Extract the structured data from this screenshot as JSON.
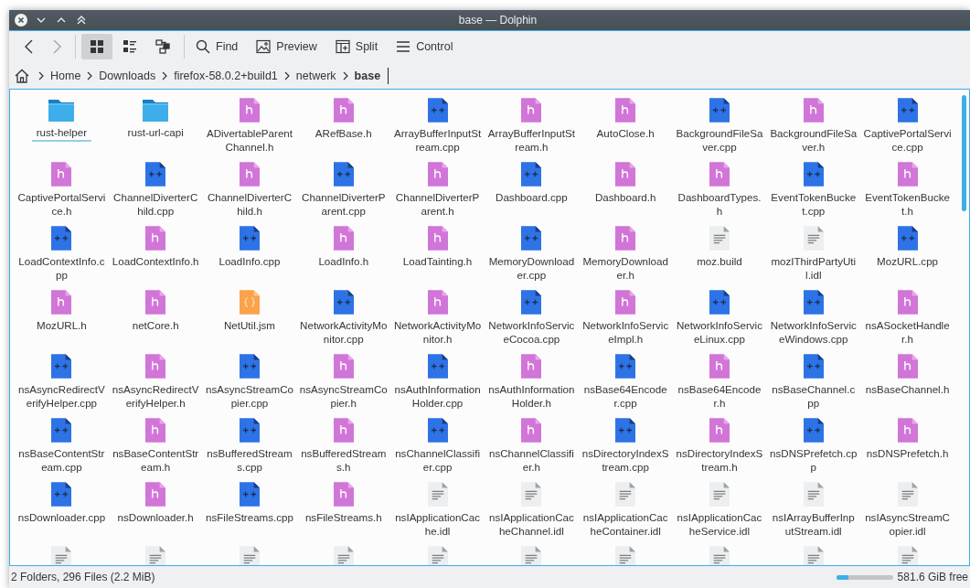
{
  "window": {
    "title": "base — Dolphin"
  },
  "toolbar": {
    "back": {
      "disabled": false
    },
    "forward": {
      "disabled": true
    },
    "view_modes": [
      {
        "kind": "icons",
        "selected": true
      },
      {
        "kind": "compact",
        "selected": false
      },
      {
        "kind": "details",
        "selected": false
      }
    ],
    "actions": [
      {
        "kind": "find",
        "label": "Find"
      },
      {
        "kind": "preview",
        "label": "Preview"
      },
      {
        "kind": "split",
        "label": "Split"
      },
      {
        "kind": "control",
        "label": "Control"
      }
    ]
  },
  "breadcrumb": [
    {
      "label": "Home",
      "current": false
    },
    {
      "label": "Downloads",
      "current": false
    },
    {
      "label": "firefox-58.0.2+build1",
      "current": false
    },
    {
      "label": "netwerk",
      "current": false
    },
    {
      "label": "base",
      "current": true
    }
  ],
  "files": [
    {
      "name": "rust-helper",
      "kind": "folder",
      "focused": true
    },
    {
      "name": "rust-url-capi",
      "kind": "folder",
      "focused": false
    },
    {
      "name": "ADivertableParentChannel.h",
      "kind": "header",
      "focused": false
    },
    {
      "name": "ARefBase.h",
      "kind": "header",
      "focused": false
    },
    {
      "name": "ArrayBufferInputStream.cpp",
      "kind": "cpp",
      "focused": false
    },
    {
      "name": "ArrayBufferInputStream.h",
      "kind": "header",
      "focused": false
    },
    {
      "name": "AutoClose.h",
      "kind": "header",
      "focused": false
    },
    {
      "name": "BackgroundFileSaver.cpp",
      "kind": "cpp",
      "focused": false
    },
    {
      "name": "BackgroundFileSaver.h",
      "kind": "header",
      "focused": false
    },
    {
      "name": "CaptivePortalService.cpp",
      "kind": "cpp",
      "focused": false
    },
    {
      "name": "CaptivePortalService.h",
      "kind": "header",
      "focused": false
    },
    {
      "name": "ChannelDiverterChild.cpp",
      "kind": "cpp",
      "focused": false
    },
    {
      "name": "ChannelDiverterChild.h",
      "kind": "header",
      "focused": false
    },
    {
      "name": "ChannelDiverterParent.cpp",
      "kind": "cpp",
      "focused": false
    },
    {
      "name": "ChannelDiverterParent.h",
      "kind": "header",
      "focused": false
    },
    {
      "name": "Dashboard.cpp",
      "kind": "cpp",
      "focused": false
    },
    {
      "name": "Dashboard.h",
      "kind": "header",
      "focused": false
    },
    {
      "name": "DashboardTypes.h",
      "kind": "header",
      "focused": false
    },
    {
      "name": "EventTokenBucket.cpp",
      "kind": "cpp",
      "focused": false
    },
    {
      "name": "EventTokenBucket.h",
      "kind": "header",
      "focused": false
    },
    {
      "name": "LoadContextInfo.cpp",
      "kind": "cpp",
      "focused": false
    },
    {
      "name": "LoadContextInfo.h",
      "kind": "header",
      "focused": false
    },
    {
      "name": "LoadInfo.cpp",
      "kind": "cpp",
      "focused": false
    },
    {
      "name": "LoadInfo.h",
      "kind": "header",
      "focused": false
    },
    {
      "name": "LoadTainting.h",
      "kind": "header",
      "focused": false
    },
    {
      "name": "MemoryDownloader.cpp",
      "kind": "cpp",
      "focused": false
    },
    {
      "name": "MemoryDownloader.h",
      "kind": "header",
      "focused": false
    },
    {
      "name": "moz.build",
      "kind": "text",
      "focused": false
    },
    {
      "name": "mozIThirdPartyUtil.idl",
      "kind": "text",
      "focused": false
    },
    {
      "name": "MozURL.cpp",
      "kind": "cpp",
      "focused": false
    },
    {
      "name": "MozURL.h",
      "kind": "header",
      "focused": false
    },
    {
      "name": "netCore.h",
      "kind": "header",
      "focused": false
    },
    {
      "name": "NetUtil.jsm",
      "kind": "script",
      "focused": false
    },
    {
      "name": "NetworkActivityMonitor.cpp",
      "kind": "cpp",
      "focused": false
    },
    {
      "name": "NetworkActivityMonitor.h",
      "kind": "header",
      "focused": false
    },
    {
      "name": "NetworkInfoServiceCocoa.cpp",
      "kind": "cpp",
      "focused": false
    },
    {
      "name": "NetworkInfoServiceImpl.h",
      "kind": "header",
      "focused": false
    },
    {
      "name": "NetworkInfoServiceLinux.cpp",
      "kind": "cpp",
      "focused": false
    },
    {
      "name": "NetworkInfoServiceWindows.cpp",
      "kind": "cpp",
      "focused": false
    },
    {
      "name": "nsASocketHandler.h",
      "kind": "header",
      "focused": false
    },
    {
      "name": "nsAsyncRedirectVerifyHelper.cpp",
      "kind": "cpp",
      "focused": false
    },
    {
      "name": "nsAsyncRedirectVerifyHelper.h",
      "kind": "header",
      "focused": false
    },
    {
      "name": "nsAsyncStreamCopier.cpp",
      "kind": "cpp",
      "focused": false
    },
    {
      "name": "nsAsyncStreamCopier.h",
      "kind": "header",
      "focused": false
    },
    {
      "name": "nsAuthInformationHolder.cpp",
      "kind": "cpp",
      "focused": false
    },
    {
      "name": "nsAuthInformationHolder.h",
      "kind": "header",
      "focused": false
    },
    {
      "name": "nsBase64Encoder.cpp",
      "kind": "cpp",
      "focused": false
    },
    {
      "name": "nsBase64Encoder.h",
      "kind": "header",
      "focused": false
    },
    {
      "name": "nsBaseChannel.cpp",
      "kind": "cpp",
      "focused": false
    },
    {
      "name": "nsBaseChannel.h",
      "kind": "header",
      "focused": false
    },
    {
      "name": "nsBaseContentStream.cpp",
      "kind": "cpp",
      "focused": false
    },
    {
      "name": "nsBaseContentStream.h",
      "kind": "header",
      "focused": false
    },
    {
      "name": "nsBufferedStreams.cpp",
      "kind": "cpp",
      "focused": false
    },
    {
      "name": "nsBufferedStreams.h",
      "kind": "header",
      "focused": false
    },
    {
      "name": "nsChannelClassifier.cpp",
      "kind": "cpp",
      "focused": false
    },
    {
      "name": "nsChannelClassifier.h",
      "kind": "header",
      "focused": false
    },
    {
      "name": "nsDirectoryIndexStream.cpp",
      "kind": "cpp",
      "focused": false
    },
    {
      "name": "nsDirectoryIndexStream.h",
      "kind": "header",
      "focused": false
    },
    {
      "name": "nsDNSPrefetch.cpp",
      "kind": "cpp",
      "focused": false
    },
    {
      "name": "nsDNSPrefetch.h",
      "kind": "header",
      "focused": false
    },
    {
      "name": "nsDownloader.cpp",
      "kind": "cpp",
      "focused": false
    },
    {
      "name": "nsDownloader.h",
      "kind": "header",
      "focused": false
    },
    {
      "name": "nsFileStreams.cpp",
      "kind": "cpp",
      "focused": false
    },
    {
      "name": "nsFileStreams.h",
      "kind": "header",
      "focused": false
    },
    {
      "name": "nsIApplicationCache.idl",
      "kind": "text",
      "focused": false
    },
    {
      "name": "nsIApplicationCacheChannel.idl",
      "kind": "text",
      "focused": false
    },
    {
      "name": "nsIApplicationCacheContainer.idl",
      "kind": "text",
      "focused": false
    },
    {
      "name": "nsIApplicationCacheService.idl",
      "kind": "text",
      "focused": false
    },
    {
      "name": "nsIArrayBufferInputStream.idl",
      "kind": "text",
      "focused": false
    },
    {
      "name": "nsIAsyncStreamCopier.idl",
      "kind": "text",
      "focused": false
    },
    {
      "kind": "text"
    },
    {
      "kind": "text"
    },
    {
      "kind": "text"
    },
    {
      "kind": "text"
    },
    {
      "kind": "text"
    },
    {
      "kind": "text"
    },
    {
      "kind": "text"
    },
    {
      "kind": "text"
    },
    {
      "kind": "text"
    },
    {
      "kind": "text"
    }
  ],
  "status_bar": {
    "summary": "2 Folders, 296 Files (2.2 MiB)",
    "free_space": {
      "level": 0.22,
      "reading": "581.6 GiB free"
    }
  }
}
